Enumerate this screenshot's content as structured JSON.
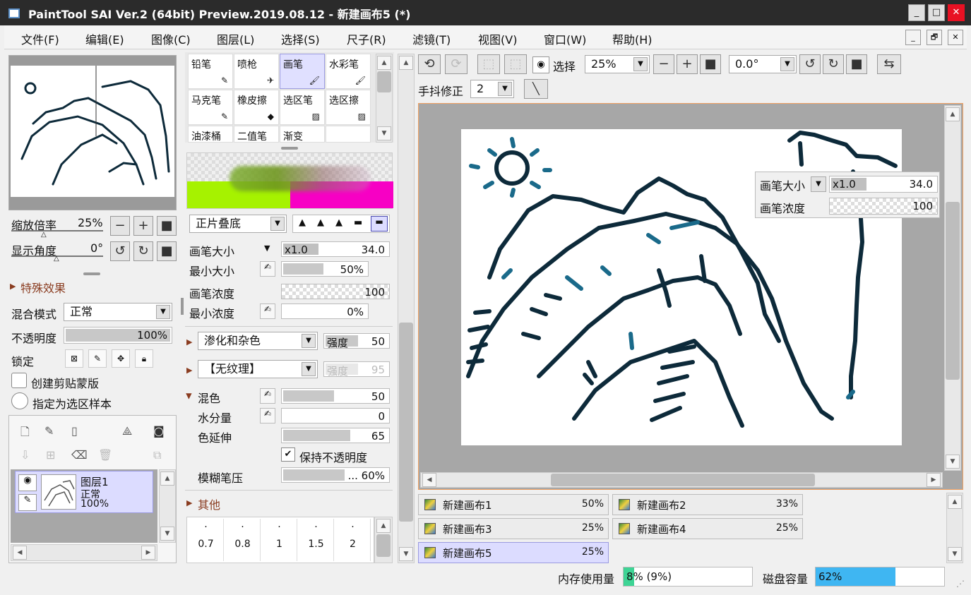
{
  "title": "PaintTool SAI Ver.2 (64bit) Preview.2019.08.12 - 新建画布5 (*)",
  "window_buttons": [
    "_",
    "□",
    "✕"
  ],
  "menu": [
    "文件(F)",
    "编辑(E)",
    "图像(C)",
    "图层(L)",
    "选择(S)",
    "尺子(R)",
    "滤镜(T)",
    "视图(V)",
    "窗口(W)",
    "帮助(H)"
  ],
  "mdi_buttons": [
    "_",
    "🗗",
    "✕"
  ],
  "nav": {
    "zoom_label": "缩放倍率",
    "zoom_value": "25%",
    "angle_label": "显示角度",
    "angle_value": "0°"
  },
  "effects": {
    "header": "特殊效果"
  },
  "layer_props": {
    "blend_label": "混合模式",
    "blend_value": "正常",
    "opacity_label": "不透明度",
    "opacity_value": "100%",
    "opacity_pct": 100,
    "lock_label": "锁定",
    "clip_label": "创建剪贴蒙版",
    "sample_label": "指定为选区样本"
  },
  "layer": {
    "name": "图层1",
    "mode": "正常",
    "opacity": "100%"
  },
  "tools": [
    [
      "铅笔",
      "喷枪",
      "画笔",
      "水彩笔"
    ],
    [
      "马克笔",
      "橡皮擦",
      "选区笔",
      "选区擦"
    ],
    [
      "油漆桶",
      "二值笔",
      "渐变",
      ""
    ]
  ],
  "brush": {
    "blend_mode": "正片叠底",
    "size_label": "画笔大小",
    "size_mult": "x1.0",
    "size_value": "34.0",
    "min_size_label": "最小大小",
    "min_size_value": "50%",
    "min_size_pct": 50,
    "density_label": "画笔浓度",
    "density_value": "100",
    "min_density_label": "最小浓度",
    "min_density_value": "0%",
    "min_density_pct": 0,
    "noise_value": "渗化和杂色",
    "noise_strength_label": "强度",
    "noise_strength": "50",
    "texture_value": "【无纹理】",
    "texture_strength_label": "强度",
    "texture_strength": "95",
    "blend_label": "混色",
    "blend_value": "50",
    "blend_pct": 50,
    "water_label": "水分量",
    "water_value": "0",
    "water_pct": 0,
    "stretch_label": "色延伸",
    "stretch_value": "65",
    "stretch_pct": 65,
    "keep_opacity_label": "保持不透明度",
    "blur_label": "模糊笔压",
    "blur_value": "... 60%",
    "blur_pct": 60,
    "other_label": "其他",
    "sizes": [
      "0.7",
      "0.8",
      "1",
      "1.5",
      "2"
    ]
  },
  "toolbar": {
    "select_label": "选择",
    "zoom": "25%",
    "angle": "0.0°",
    "stabilizer_label": "手抖修正",
    "stabilizer": "2"
  },
  "overlay": {
    "size_label": "画笔大小",
    "size_mult": "x1.0",
    "size_value": "34.0",
    "density_label": "画笔浓度",
    "density_value": "100"
  },
  "canvases": [
    {
      "name": "新建画布1",
      "zoom": "50%"
    },
    {
      "name": "新建画布2",
      "zoom": "33%"
    },
    {
      "name": "新建画布3",
      "zoom": "25%"
    },
    {
      "name": "新建画布4",
      "zoom": "25%"
    },
    {
      "name": "新建画布5",
      "zoom": "25%"
    }
  ],
  "status": {
    "memory_label": "内存使用量",
    "memory_value": "8% (9%)",
    "memory_pct": 8,
    "disk_label": "磁盘容量",
    "disk_value": "62%",
    "disk_pct": 62
  },
  "colors": {
    "accent": "#dcdcff",
    "memory_bar": "#3ed495",
    "disk_bar": "#3fb6f2",
    "stroke": "#0d2a3a",
    "stroke_blue": "#1a6a8a"
  }
}
